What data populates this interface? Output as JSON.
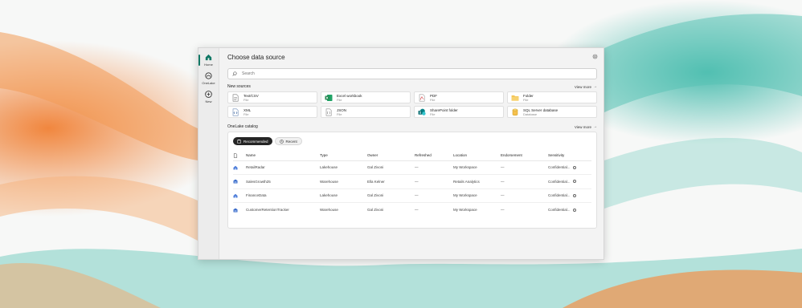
{
  "rail": {
    "items": [
      {
        "label": "Home",
        "icon": "home-icon",
        "active": true
      },
      {
        "label": "OneLake",
        "icon": "onelake-icon",
        "active": false
      },
      {
        "label": "New",
        "icon": "add-icon",
        "active": false
      }
    ]
  },
  "dialog": {
    "title": "Choose data source",
    "settings_icon": "gear-icon"
  },
  "search": {
    "placeholder": "Search"
  },
  "new_sources": {
    "title": "New sources",
    "view_more": "View more",
    "items": [
      {
        "name": "Text/CSV",
        "sub": "File",
        "icon": "text-csv-icon"
      },
      {
        "name": "Excel workbook",
        "sub": "File",
        "icon": "excel-icon"
      },
      {
        "name": "PDF",
        "sub": "File",
        "icon": "pdf-icon"
      },
      {
        "name": "Folder",
        "sub": "File",
        "icon": "folder-icon"
      },
      {
        "name": "XML",
        "sub": "File",
        "icon": "xml-icon"
      },
      {
        "name": "JSON",
        "sub": "File",
        "icon": "json-icon"
      },
      {
        "name": "SharePoint folder",
        "sub": "File",
        "icon": "sharepoint-icon"
      },
      {
        "name": "SQL Server database",
        "sub": "Database",
        "icon": "database-icon"
      }
    ]
  },
  "catalog": {
    "title": "OneLake catalog",
    "view_more": "View more",
    "pills": {
      "recommended": "Recommended",
      "recent": "Recent"
    },
    "columns": {
      "name": "Name",
      "type": "Type",
      "owner": "Owner",
      "refreshed": "Refreshed",
      "location": "Location",
      "endorsement": "Endorsement",
      "sensitivity": "Sensitivity"
    },
    "rows": [
      {
        "name": "RetailRadar",
        "type": "Lakehouse",
        "owner": "Gal Zivoni",
        "refreshed": "—",
        "location": "My Workspace",
        "endorsement": "—",
        "sensitivity": "Confidential..."
      },
      {
        "name": "SalesGrowth25",
        "type": "Warehouse",
        "owner": "Ella Kelner",
        "refreshed": "—",
        "location": "Retails Analytics",
        "endorsement": "—",
        "sensitivity": "Confidential..."
      },
      {
        "name": "FinanceData",
        "type": "Lakehouse",
        "owner": "Gal Zivoni",
        "refreshed": "—",
        "location": "My Workspace",
        "endorsement": "—",
        "sensitivity": "Confidential..."
      },
      {
        "name": "CustomerRetentionTracker",
        "type": "Warehouse",
        "owner": "Gal Zivoni",
        "refreshed": "—",
        "location": "My Workspace",
        "endorsement": "—",
        "sensitivity": "Confidential..."
      }
    ]
  },
  "colors": {
    "accent": "#117865",
    "orange_wave": "#f08a3c",
    "teal_wave": "#3fb8a8"
  }
}
